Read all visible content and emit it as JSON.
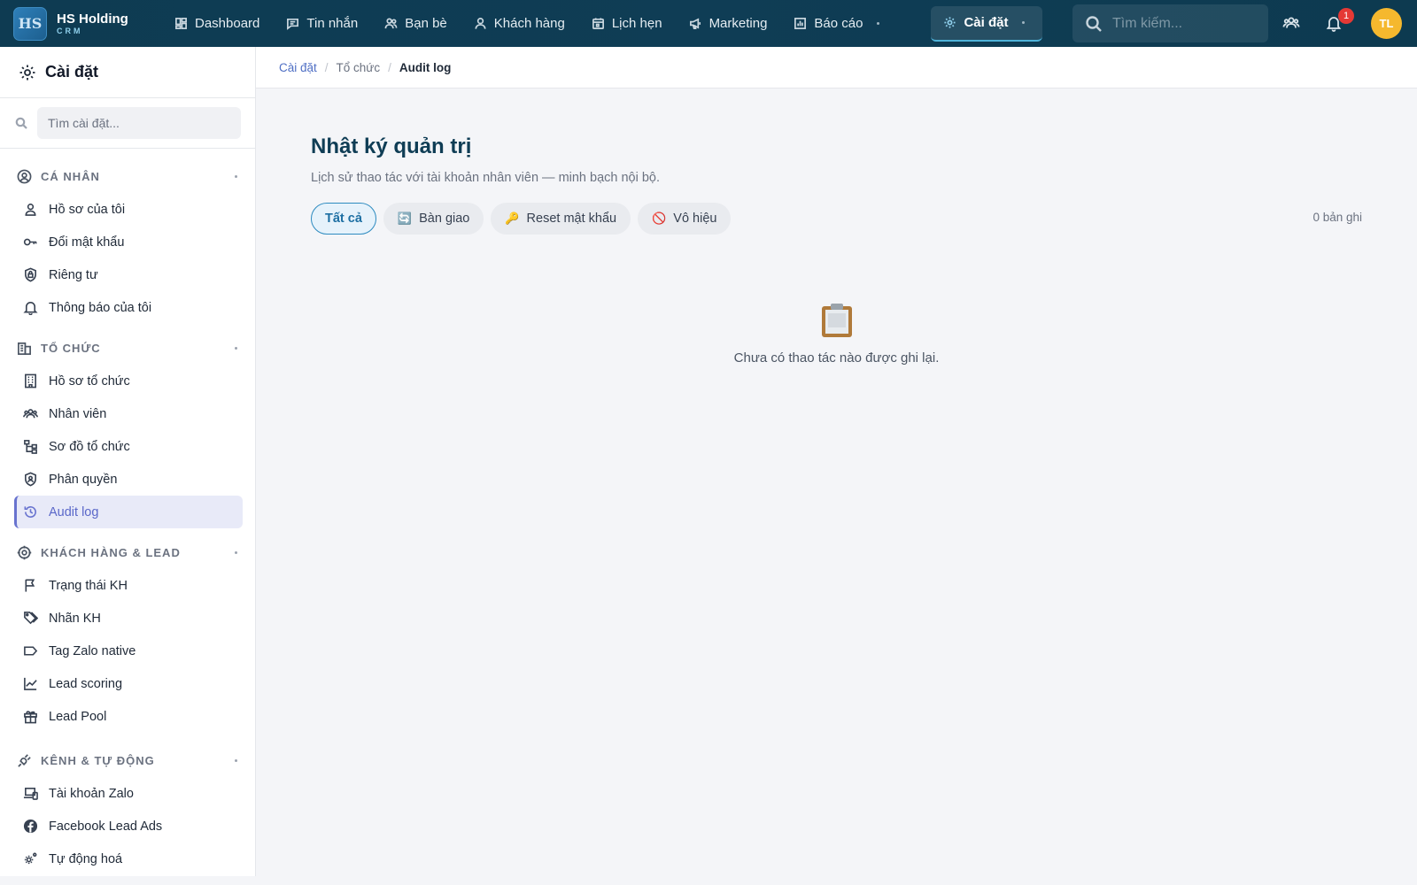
{
  "brand": {
    "logo": "HS",
    "name": "HS Holding",
    "sub": "CRM"
  },
  "nav": [
    {
      "label": "Dashboard",
      "icon": "dashboard-icon"
    },
    {
      "label": "Tin nhắn",
      "icon": "message-icon"
    },
    {
      "label": "Bạn bè",
      "icon": "friends-icon"
    },
    {
      "label": "Khách hàng",
      "icon": "customer-icon"
    },
    {
      "label": "Lịch hẹn",
      "icon": "calendar-icon"
    },
    {
      "label": "Marketing",
      "icon": "megaphone-icon"
    },
    {
      "label": "Báo cáo",
      "icon": "report-icon"
    },
    {
      "label": "Cài đặt",
      "icon": "gear-icon",
      "active": true
    }
  ],
  "topbar": {
    "search_placeholder": "Tìm kiếm...",
    "notification_count": "1",
    "avatar_initials": "TL"
  },
  "sidebar": {
    "title": "Cài đặt",
    "search_placeholder": "Tìm cài đặt...",
    "sections": [
      {
        "title": "CÁ NHÂN",
        "items": [
          "Hồ sơ của tôi",
          "Đổi mật khẩu",
          "Riêng tư",
          "Thông báo của tôi"
        ]
      },
      {
        "title": "TỔ CHỨC",
        "items": [
          "Hồ sơ tổ chức",
          "Nhân viên",
          "Sơ đồ tổ chức",
          "Phân quyền",
          "Audit log"
        ]
      },
      {
        "title": "KHÁCH HÀNG & LEAD",
        "items": [
          "Trạng thái KH",
          "Nhãn KH",
          "Tag Zalo native",
          "Lead scoring",
          "Lead Pool"
        ]
      },
      {
        "title": "KÊNH & TỰ ĐỘNG",
        "items": [
          "Tài khoản Zalo",
          "Facebook Lead Ads",
          "Tự động hoá"
        ]
      }
    ]
  },
  "breadcrumb": [
    "Cài đặt",
    "Tổ chức",
    "Audit log"
  ],
  "page": {
    "title": "Nhật ký quản trị",
    "subtitle": "Lịch sử thao tác với tài khoản nhân viên — minh bạch nội bộ.",
    "filters": [
      {
        "label": "Tất cả",
        "icon": ""
      },
      {
        "label": "Bàn giao",
        "icon": "🔄"
      },
      {
        "label": "Reset mật khẩu",
        "icon": "🔑"
      },
      {
        "label": "Vô hiệu",
        "icon": "🚫"
      }
    ],
    "active_filter": "Tất cả",
    "record_count": "0 bản ghi",
    "empty_text": "Chưa có thao tác nào được ghi lại.",
    "empty_icon": "clipboard-icon"
  },
  "colors": {
    "topbar": "#0e3b52",
    "accent": "#2e8bc0",
    "active_nav": "#6873cf",
    "avatar": "#f5b82e",
    "badge": "#e53935",
    "title": "#0f3d55"
  }
}
